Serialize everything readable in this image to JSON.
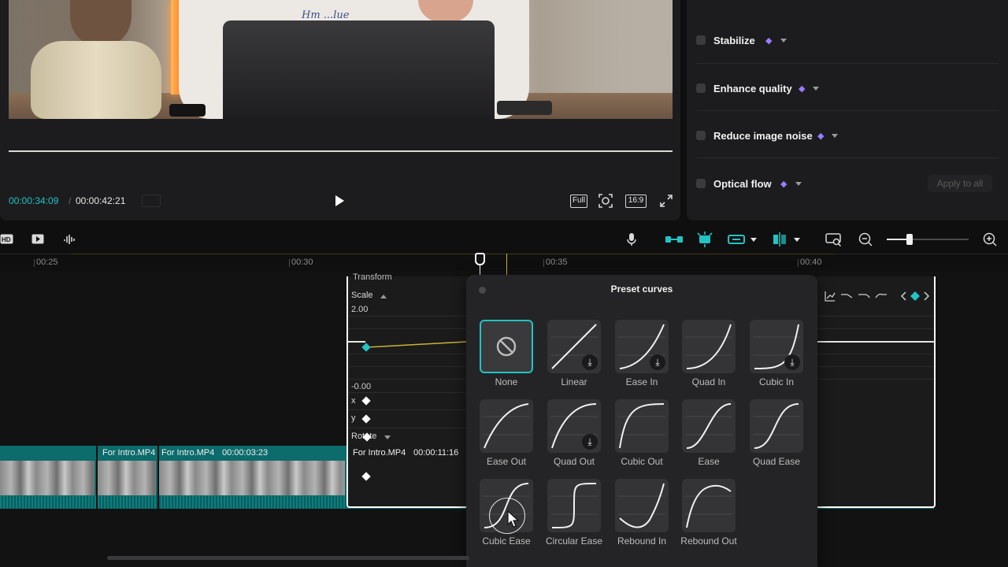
{
  "preview": {
    "time_current": "00:00:34:09",
    "time_separator": "/",
    "time_total": "00:00:42:21",
    "video_brand_text": "Hm    ...lue",
    "buttons": {
      "full": "Full",
      "ratio": "16:9"
    }
  },
  "right_panel": {
    "options": [
      {
        "label": "Stabilize",
        "premium": true
      },
      {
        "label": "Enhance quality",
        "premium": true
      },
      {
        "label": "Reduce image noise",
        "premium": true
      },
      {
        "label": "Optical flow",
        "premium": true
      }
    ],
    "apply_all": "Apply to all"
  },
  "toolbar": {
    "left": [
      "hd-icon",
      "play-frame-icon",
      "audio-split-icon"
    ],
    "right": [
      "microphone-icon",
      "link-clips-icon",
      "auto-snap-icon",
      "preview-axis-icon",
      "split-view-icon",
      "fit-timeline-icon",
      "zoom-out-icon",
      "zoom-in-icon"
    ],
    "zoom_level": 0.28
  },
  "ruler": {
    "ticks": [
      "00:25",
      "00:30",
      "00:35",
      "00:40"
    ]
  },
  "tracks": {
    "clips": [
      {
        "label": "For Intro.MP4"
      },
      {
        "label": "For Intro.MP4"
      },
      {
        "label": "00:00:03:23"
      },
      {
        "label": "For Intro.MP4"
      },
      {
        "label": "00:00:11:16"
      }
    ]
  },
  "keyframe_editor": {
    "top_label": "Transform",
    "scale_label": "Scale",
    "scale_max": "2.00",
    "scale_min": "-0.00",
    "rows": [
      "x",
      "y",
      "Rotate"
    ]
  },
  "preset_popup": {
    "title": "Preset curves",
    "presets": [
      {
        "label": "None",
        "selected": true,
        "download": false
      },
      {
        "label": "Linear",
        "download": true
      },
      {
        "label": "Ease In",
        "download": true
      },
      {
        "label": "Quad In",
        "download": false
      },
      {
        "label": "Cubic In",
        "download": true
      },
      {
        "label": "Ease Out",
        "download": false
      },
      {
        "label": "Quad Out",
        "download": true
      },
      {
        "label": "Cubic Out",
        "download": false
      },
      {
        "label": "Ease",
        "download": false
      },
      {
        "label": "Quad Ease",
        "download": false
      },
      {
        "label": "Cubic Ease",
        "download": false
      },
      {
        "label": "Circular Ease",
        "download": false
      },
      {
        "label": "Rebound In",
        "download": false
      },
      {
        "label": "Rebound Out",
        "download": false
      }
    ]
  },
  "colors": {
    "accent": "#22c3c3",
    "premium": "#9b7bff",
    "clip_track": "#0c6b6b"
  }
}
